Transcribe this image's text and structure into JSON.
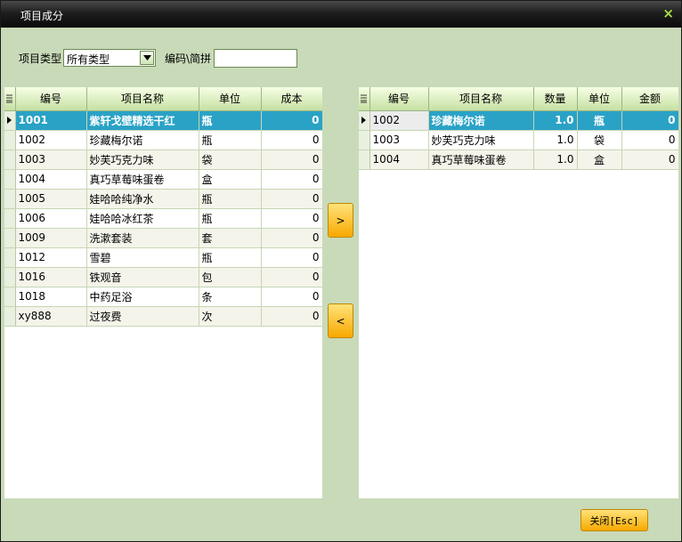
{
  "window": {
    "title": "项目成分",
    "close_glyph": "×"
  },
  "filter": {
    "type_label": "项目类型",
    "type_selected": "所有类型",
    "code_label": "编码\\简拼",
    "code_value": ""
  },
  "left_grid": {
    "columns": [
      "编号",
      "项目名称",
      "单位",
      "成本"
    ],
    "rows": [
      {
        "code": "1001",
        "name": "紫轩戈壁精选干红",
        "unit": "瓶",
        "cost": "0"
      },
      {
        "code": "1002",
        "name": "珍藏梅尔诺",
        "unit": "瓶",
        "cost": "0"
      },
      {
        "code": "1003",
        "name": "妙芙巧克力味",
        "unit": "袋",
        "cost": "0"
      },
      {
        "code": "1004",
        "name": "真巧草莓味蛋卷",
        "unit": "盒",
        "cost": "0"
      },
      {
        "code": "1005",
        "name": "娃哈哈纯净水",
        "unit": "瓶",
        "cost": "0"
      },
      {
        "code": "1006",
        "name": "娃哈哈冰红茶",
        "unit": "瓶",
        "cost": "0"
      },
      {
        "code": "1009",
        "name": "洗漱套装",
        "unit": "套",
        "cost": "0"
      },
      {
        "code": "1012",
        "name": "雪碧",
        "unit": "瓶",
        "cost": "0"
      },
      {
        "code": "1016",
        "name": "铁观音",
        "unit": "包",
        "cost": "0"
      },
      {
        "code": "1018",
        "name": "中药足浴",
        "unit": "条",
        "cost": "0"
      },
      {
        "code": "xy888",
        "name": "过夜费",
        "unit": "次",
        "cost": "0"
      }
    ]
  },
  "right_grid": {
    "columns": [
      "编号",
      "项目名称",
      "数量",
      "单位",
      "金额"
    ],
    "rows": [
      {
        "code": "1002",
        "name": "珍藏梅尔诺",
        "qty": "1.0",
        "unit": "瓶",
        "amount": "0"
      },
      {
        "code": "1003",
        "name": "妙芙巧克力味",
        "qty": "1.0",
        "unit": "袋",
        "amount": "0"
      },
      {
        "code": "1004",
        "name": "真巧草莓味蛋卷",
        "qty": "1.0",
        "unit": "盒",
        "amount": "0"
      }
    ]
  },
  "buttons": {
    "add": ">",
    "remove": "<",
    "close": "关闭[Esc]"
  }
}
